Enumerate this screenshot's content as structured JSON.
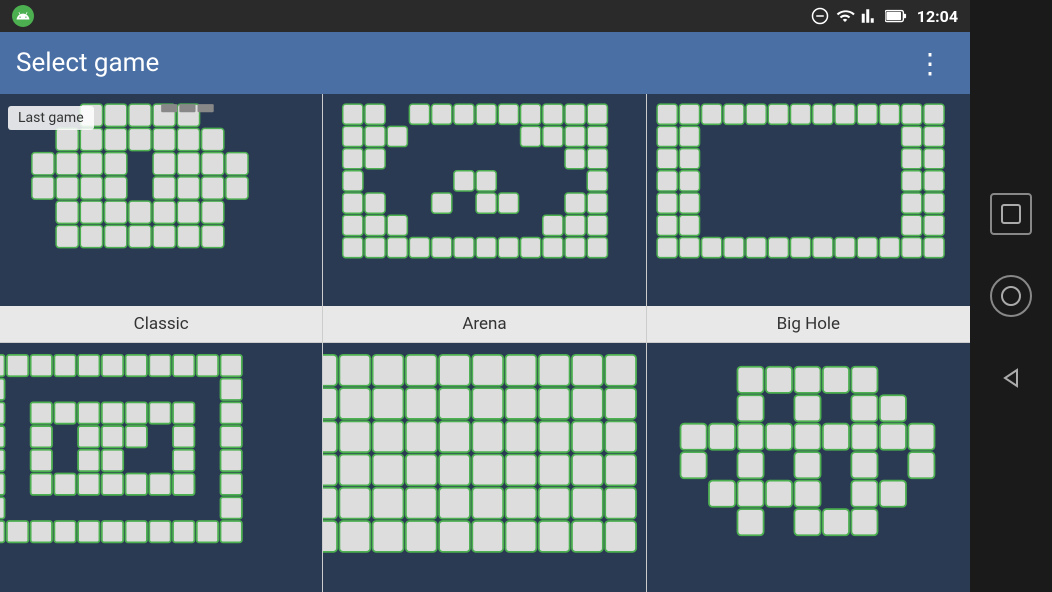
{
  "statusBar": {
    "time": "12:04",
    "icons": [
      "minus-circle",
      "wifi",
      "signal",
      "battery"
    ]
  },
  "topBar": {
    "title": "Select game",
    "moreMenuLabel": "⋮"
  },
  "games": [
    {
      "id": "classic",
      "label": "Classic",
      "isLastGame": true,
      "lastGameLabel": "Last game",
      "layout": "classic"
    },
    {
      "id": "arena",
      "label": "Arena",
      "isLastGame": false,
      "layout": "arena"
    },
    {
      "id": "big-hole",
      "label": "Big Hole",
      "isLastGame": false,
      "layout": "bighole"
    },
    {
      "id": "spiral",
      "label": "",
      "isLastGame": false,
      "layout": "spiral"
    },
    {
      "id": "full",
      "label": "",
      "isLastGame": false,
      "layout": "full"
    },
    {
      "id": "cross",
      "label": "",
      "isLastGame": false,
      "layout": "cross"
    }
  ],
  "navigation": {
    "squareLabel": "□",
    "circleLabel": "○",
    "triangleLabel": "◁"
  }
}
